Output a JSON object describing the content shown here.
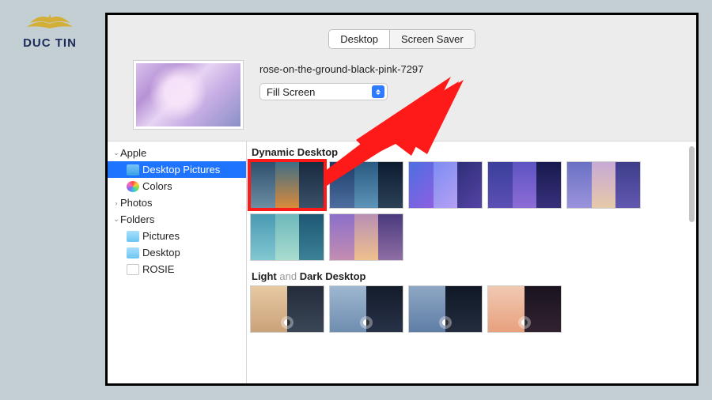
{
  "watermark": {
    "brand": "DUC TIN"
  },
  "tabs": {
    "desktop": "Desktop",
    "screensaver": "Screen Saver",
    "active": "desktop"
  },
  "current": {
    "filename": "rose-on-the-ground-black-pink-7297",
    "fillmode": "Fill Screen"
  },
  "sidebar": {
    "items": [
      {
        "label": "Apple",
        "type": "group",
        "expanded": true
      },
      {
        "label": "Desktop Pictures",
        "type": "folder",
        "selected": true
      },
      {
        "label": "Colors",
        "type": "colors"
      },
      {
        "label": "Photos",
        "type": "group",
        "expanded": false
      },
      {
        "label": "Folders",
        "type": "group",
        "expanded": true
      },
      {
        "label": "Pictures",
        "type": "folder-lite"
      },
      {
        "label": "Desktop",
        "type": "folder-lite"
      },
      {
        "label": "ROSIE",
        "type": "blank"
      }
    ]
  },
  "sections": {
    "dynamic": {
      "title": "Dynamic Desktop",
      "count": 7,
      "selected_index": 0
    },
    "lightdark": {
      "title_pre": "Light",
      "title_mid": " and ",
      "title_post": "Dark Desktop",
      "count": 4
    }
  }
}
